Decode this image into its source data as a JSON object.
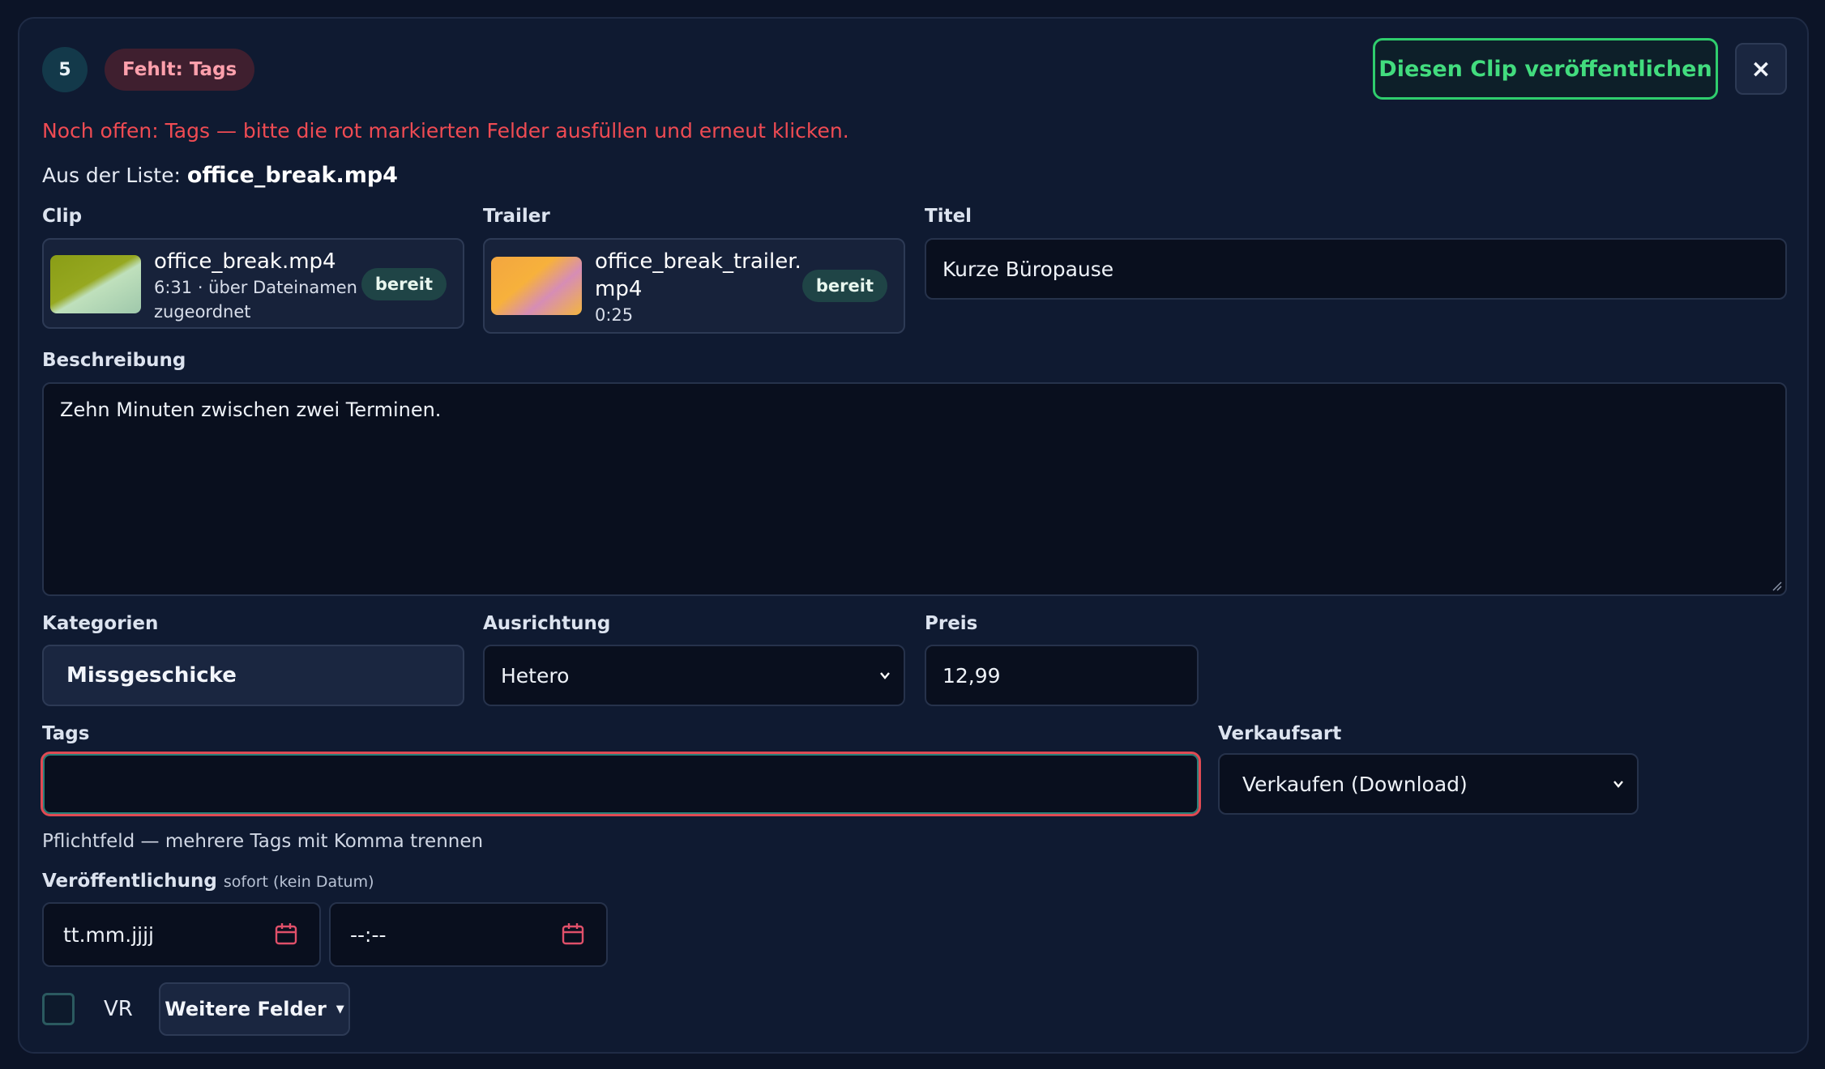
{
  "header": {
    "step_number": "5",
    "missing_badge": "Fehlt: Tags",
    "publish_button": "Diesen Clip veröffentlichen",
    "close_label": "×"
  },
  "error_message": "Noch offen: Tags — bitte die rot markierten Felder ausfüllen und erneut klicken.",
  "source": {
    "prefix": "Aus der Liste: ",
    "filename": "office_break.mp4"
  },
  "clip": {
    "label": "Clip",
    "file_name": "office_break.mp4",
    "meta_line1": "6:31 · über Dateinamen",
    "meta_line2": "zugeordnet",
    "status": "bereit"
  },
  "trailer": {
    "label": "Trailer",
    "file_name_line1": "office_break_trailer.",
    "file_name_line2": "mp4",
    "duration": "0:25",
    "status": "bereit"
  },
  "title_field": {
    "label": "Titel",
    "value": "Kurze Büropause"
  },
  "description": {
    "label": "Beschreibung",
    "value": "Zehn Minuten zwischen zwei Terminen."
  },
  "categories": {
    "label": "Kategorien",
    "value": "Missgeschicke"
  },
  "orientation": {
    "label": "Ausrichtung",
    "value": "Hetero"
  },
  "price": {
    "label": "Preis",
    "value": "12,99"
  },
  "tags": {
    "label": "Tags",
    "value": "",
    "hint": "Pflichtfeld — mehrere Tags mit Komma trennen"
  },
  "sale_type": {
    "label": "Verkaufsart",
    "value": "Verkaufen (Download)"
  },
  "publication": {
    "label": "Veröffentlichung",
    "sublabel": "sofort (kein Datum)",
    "date_placeholder": "tt.mm.jjjj",
    "time_placeholder": "--:--"
  },
  "vr": {
    "label": "VR",
    "checked": false
  },
  "more_fields_button": "Weitere Felder",
  "more_fields_caret": "▼",
  "colors": {
    "background": "#0c1427",
    "card": "#0f1a31",
    "accent_green": "#42dc7e",
    "error_red": "#ef4b53",
    "badge_red_text": "#ffa0ac",
    "ready_pill": "#1f4446"
  }
}
